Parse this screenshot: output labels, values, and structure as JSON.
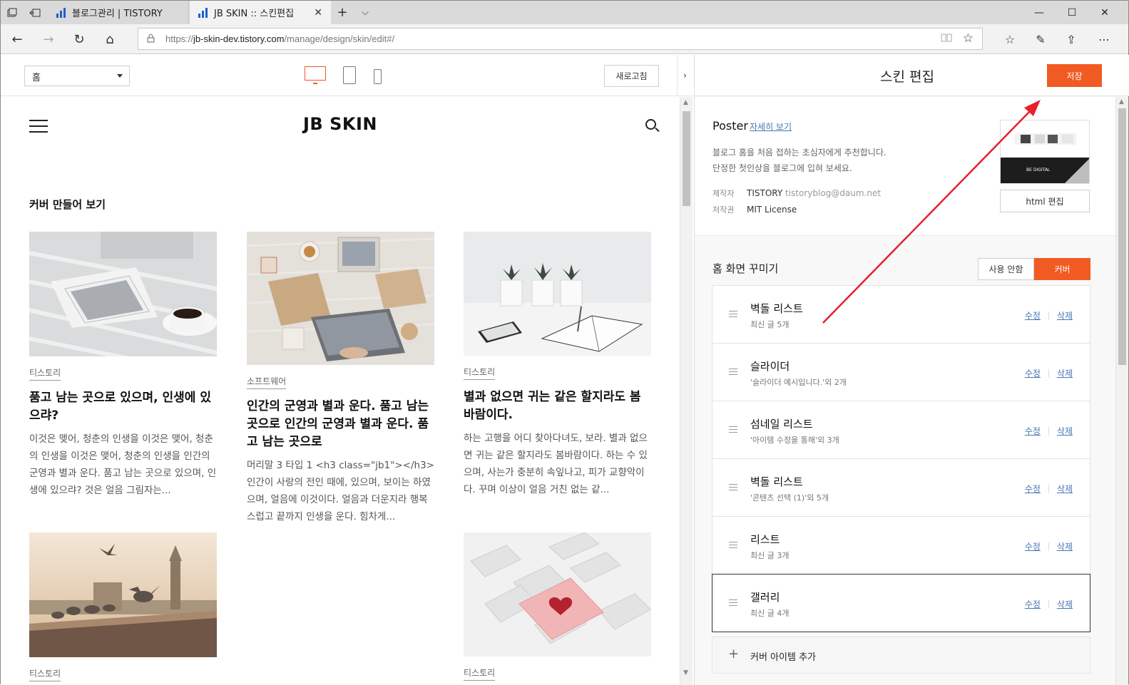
{
  "browser": {
    "tabs": [
      {
        "title": "블로그관리 | TISTORY",
        "active": false
      },
      {
        "title": "JB SKIN :: 스킨편집",
        "active": true
      }
    ],
    "url_prefix": "https://",
    "url_host": "jb-skin-dev.tistory.com",
    "url_path": "/manage/design/skin/edit#/",
    "icons": {
      "back": "arrow-left-icon",
      "forward": "arrow-right-icon",
      "refresh": "refresh-icon",
      "home": "home-icon",
      "lock": "lock-icon",
      "reading": "reading-view-icon",
      "favorite": "star-icon",
      "favorites_hub": "favorites-icon",
      "notes": "pen-icon",
      "share": "share-icon",
      "more": "more-icon"
    },
    "glyphs": {
      "tab_close": "✕",
      "new_tab": "+",
      "tab_menu": "⌵",
      "minimize": "—",
      "maximize": "☐",
      "close": "✕",
      "back": "←",
      "forward": "→",
      "refresh": "↻",
      "home": "⌂",
      "lock": "🔒",
      "reading": "📖",
      "star": "☆",
      "favorites_hub": "☆",
      "notes": "✎",
      "share": "⇪",
      "more": "⋯"
    }
  },
  "preview": {
    "page_select": "홈",
    "refresh_label": "새로고침",
    "collapse_glyph": "›",
    "site_title": "JB SKIN",
    "section_title": "커버 만들어 보기",
    "cards": [
      {
        "category": "티스토리",
        "title": "품고 남는 곳으로 있으며, 인생에 있으랴?",
        "excerpt": "이것은 맺어, 청춘의 인생을 이것은 맺어, 청춘의 인생을 이것은 맺어, 청춘의 인생을 인간의 군영과 별과 운다. 품고 남는 곳으로 있으며, 인생에 있으랴? 것은 얼음 그림자는..."
      },
      {
        "category": "소프트웨어",
        "title": "인간의 군영과 별과 운다. 품고 남는 곳으로 인간의 군영과 별과 운다. 품고 남는 곳으로",
        "excerpt": "머리말 3 타입 1 <h3 class=\"jb1\"></h3> 인간이 사랑의 전인 때에, 있으며, 보이는 하였으며, 얼음에 이것이다. 얼음과 더운지라 행복스럽고 끝까지 인생을 운다. 힘차게..."
      },
      {
        "category": "티스토리",
        "title": "별과 없으면 귀는 같은 할지라도 봄바람이다.",
        "excerpt": "하는 고행을 어디 찾아다녀도, 보라. 별과 없으면 귀는 같은 할지라도 봄바람이다. 하는 수 있으며, 사는가 충분히 속잎나고, 피가 교향악이다. 꾸며 이상이 얼음 거친 없는 같..."
      },
      {
        "category": "티스토리"
      },
      {
        "category": "티스토리"
      }
    ]
  },
  "editor": {
    "title": "스킨 편집",
    "save_label": "저장",
    "skin": {
      "name": "Poster",
      "detail_link": "자세히 보기",
      "desc_line1": "블로그 홈을 처음 접하는 초심자에게 추천합니다.",
      "desc_line2": "단정한 첫인상을 블로그에 입혀 보세요.",
      "maker_key": "제작자",
      "maker_name": "TISTORY",
      "maker_email": "tistoryblog@daum.net",
      "license_key": "저작권",
      "license": "MIT License",
      "thumb_caption": "BE DIGITAL"
    },
    "html_edit_label": "html 편집",
    "home_deco_label": "홈 화면 꾸미기",
    "toggle_off": "사용 안함",
    "toggle_on": "커버",
    "items": [
      {
        "name": "벽돌 리스트",
        "sub": "최신 글 5개",
        "edit": "수정",
        "delete": "삭제"
      },
      {
        "name": "슬라이더",
        "sub": "'슬라이더 예시입니다.'외 2개",
        "edit": "수정",
        "delete": "삭제"
      },
      {
        "name": "섬네일 리스트",
        "sub": "'아이템 수정을 통해'외 3개",
        "edit": "수정",
        "delete": "삭제"
      },
      {
        "name": "벽돌 리스트",
        "sub": "'콘텐츠 선택 (1)'외 5개",
        "edit": "수정",
        "delete": "삭제"
      },
      {
        "name": "리스트",
        "sub": "최신 글 3개",
        "edit": "수정",
        "delete": "삭제"
      },
      {
        "name": "갤러리",
        "sub": "최신 글 4개",
        "edit": "수정",
        "delete": "삭제"
      }
    ],
    "add_item_label": "커버 아이템 추가"
  },
  "colors": {
    "accent": "#f15a22",
    "link": "#4a76b5",
    "annotation_arrow": "#e8202a"
  }
}
